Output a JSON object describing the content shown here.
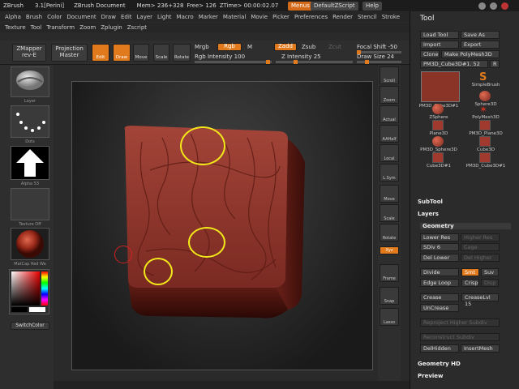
{
  "titlebar": {
    "app": "ZBrush",
    "version": "3.1[Perini]",
    "document": "ZBrush Document",
    "mem": "Mem> 236+328",
    "free": "Free> 126",
    "ztime": "ZTime> 00:00:02.07",
    "menus": "Menus",
    "script": "DefaultZScript",
    "help": "Help"
  },
  "menus_row1": [
    "Alpha",
    "Brush",
    "Color",
    "Document",
    "Draw",
    "Edit",
    "Layer",
    "Light",
    "Macro",
    "Marker",
    "Material",
    "Movie",
    "Picker",
    "Preferences",
    "Render",
    "Stencil",
    "Stroke"
  ],
  "menus_row2": [
    "Texture",
    "Tool",
    "Transform",
    "Zoom",
    "Zplugin",
    "Zscript"
  ],
  "shelf": {
    "zmapper": "ZMapper",
    "zmapper_sub": "rev-E",
    "projection": "Projection",
    "projection_sub": "Master",
    "edit": "Edit",
    "draw": "Draw",
    "move": "Move",
    "scale": "Scale",
    "rotate": "Rotate",
    "mrgb": "Mrgb",
    "rgb": "Rgb",
    "m": "M",
    "rgb_intensity": "Rgb Intensity 100",
    "zadd": "Zadd",
    "zsub": "Zsub",
    "zcut": "Zcut",
    "z_intensity": "Z Intensity 25",
    "focal_shift": "Focal Shift -50",
    "draw_size": "Draw Size 24",
    "rgb_intensity_value": 1.0,
    "z_intensity_value": 0.25,
    "focal_shift_value": -50,
    "draw_size_value": 24
  },
  "lefttray": {
    "brush_label": "Layer",
    "stroke_label": "Dots",
    "alpha_label": "Alpha 53",
    "texture_label": "Texture Off",
    "material_label": "MatCap Red Wa",
    "switchcolor": "SwitchColor"
  },
  "righttoolbar": [
    "Scroll",
    "Zoom",
    "Actual",
    "AAHalf",
    "Local",
    "L.Sym",
    "Move",
    "Scale",
    "Rotate",
    "Xyz",
    "Frame",
    "Snap",
    "Lasso"
  ],
  "tool": {
    "title": "Tool",
    "load": "Load Tool",
    "save": "Save As",
    "import": "Import",
    "export": "Export",
    "clone": "Clone",
    "make": "Make PolyMesh3D",
    "current": "PM3D_Cube3D#1. 52",
    "r": "R",
    "items": [
      "PM3D_Cube3D#1",
      "SimpleBrush",
      "Sphere3D",
      "ZSphere",
      "PolyMesh3D",
      "Plane3D",
      "PM3D_Plane3D",
      "PM3D_Sphere3D",
      "Cube3D",
      "Cube3D#1",
      "PM3D_Cube3D#1"
    ],
    "subtool": "SubTool",
    "layers": "Layers",
    "geometry": "Geometry",
    "lower_res": "Lower Res",
    "higher_res": "Higher Res",
    "sdiv": "SDiv 6",
    "cage": "Cage",
    "del_lower": "Del Lower",
    "del_higher": "Del Higher",
    "divide": "Divide",
    "smt": "Smt",
    "suv": "Suv",
    "edge_loop": "Edge Loop",
    "crisp": "Crisp",
    "disp": "Disp",
    "crease": "Crease",
    "crease_lvl": "CreaseLvl 15",
    "uncrease": "UnCrease",
    "reproject": "Reproject Higher Subdiv",
    "reconstruct": "Reconstruct Subdiv",
    "delhidden": "DelHidden",
    "insertmesh": "InsertMesh",
    "geometry_hd": "Geometry HD",
    "preview": "Preview"
  },
  "colors": {
    "accent": "#e07a1c",
    "clay": "#7a2a22",
    "annotation": "#f2e81a"
  }
}
